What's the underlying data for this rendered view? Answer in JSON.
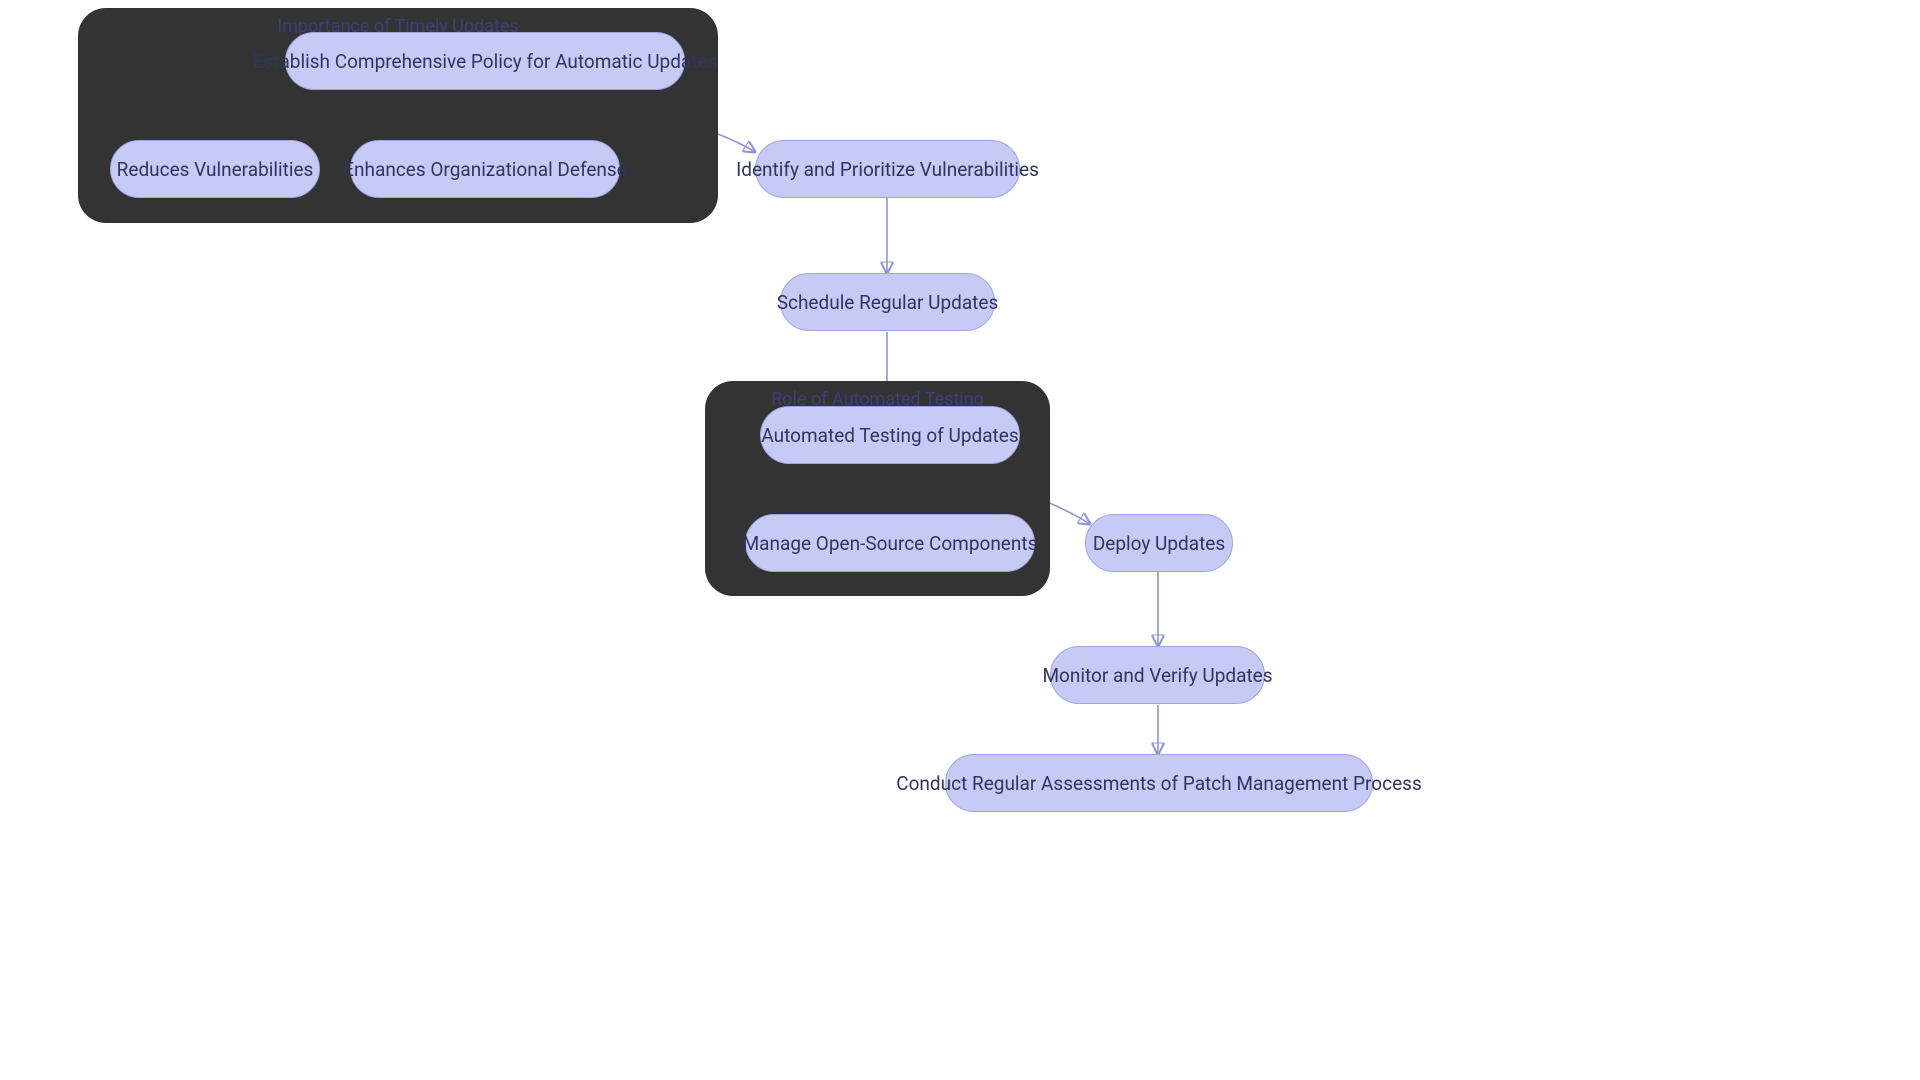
{
  "groups": {
    "g1": {
      "title": "Importance of Timely Updates"
    },
    "g2": {
      "title": "Role of Automated Testing"
    }
  },
  "nodes": {
    "n1": "Establish Comprehensive Policy for Automatic Updates",
    "n2": "Reduces Vulnerabilities",
    "n3": "Enhances Organizational Defense",
    "n4": "Identify and Prioritize Vulnerabilities",
    "n5": "Schedule Regular Updates",
    "n6": "Automated Testing of Updates",
    "n7": "Manage Open-Source Components",
    "n8": "Deploy Updates",
    "n9": "Monitor and Verify Updates",
    "n10": "Conduct Regular Assessments of Patch Management Process"
  }
}
